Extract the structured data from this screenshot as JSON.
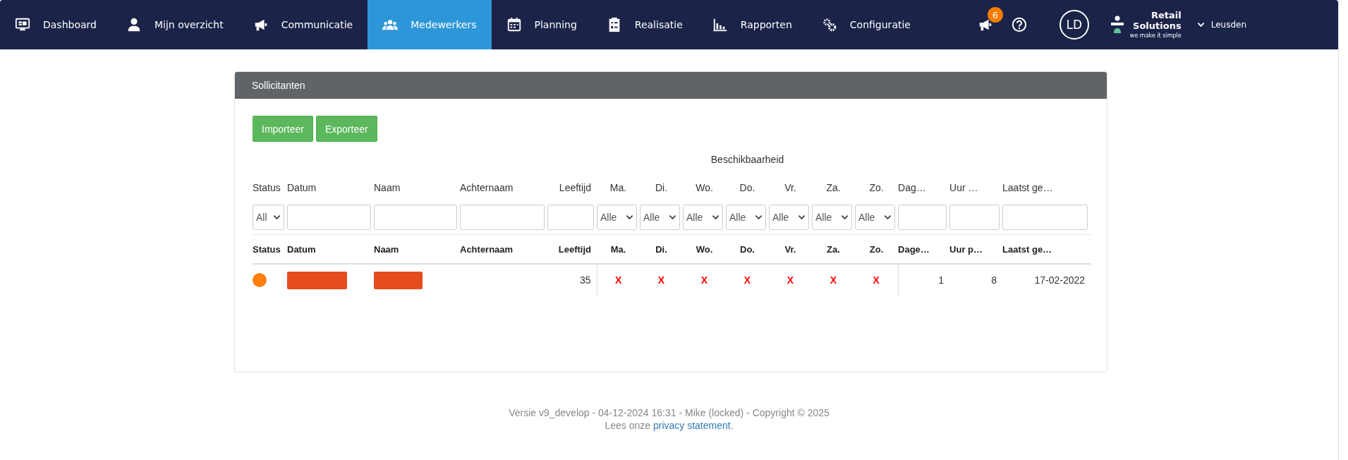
{
  "nav": {
    "items": [
      {
        "label": "Dashboard",
        "selected": false
      },
      {
        "label": "Mijn overzicht",
        "selected": false
      },
      {
        "label": "Communicatie",
        "selected": false
      },
      {
        "label": "Medewerkers",
        "selected": true
      },
      {
        "label": "Planning",
        "selected": false
      },
      {
        "label": "Realisatie",
        "selected": false
      },
      {
        "label": "Rapporten",
        "selected": false
      },
      {
        "label": "Configuratie",
        "selected": false
      }
    ],
    "notifications": {
      "count": "6"
    },
    "avatar": "LD",
    "logo": {
      "line_1": "Retail",
      "line_2": "Solutions",
      "tagline": "we make it simple"
    },
    "location": "Leusden"
  },
  "panel": {
    "title": "Sollicitanten",
    "buttons": [
      "Importeer",
      "Exporteer"
    ],
    "table": {
      "group_header": "Beschikbaarheid",
      "filter_labels": [
        "Status",
        "Datum",
        "Naam",
        "Achternaam",
        "Leeftijd",
        "Ma.",
        "Di.",
        "Wo.",
        "Do.",
        "Vr.",
        "Za.",
        "Zo.",
        "Dag…",
        "Uur …",
        "Laatst ge…"
      ],
      "filters": [
        {
          "kind": "select",
          "value": "All"
        },
        {
          "kind": "text"
        },
        {
          "kind": "text"
        },
        {
          "kind": "text"
        },
        {
          "kind": "text"
        },
        {
          "kind": "select",
          "value": "Alle"
        },
        {
          "kind": "select",
          "value": "Alle"
        },
        {
          "kind": "select",
          "value": "Alle"
        },
        {
          "kind": "select",
          "value": "Alle"
        },
        {
          "kind": "select",
          "value": "Alle"
        },
        {
          "kind": "select",
          "value": "Alle"
        },
        {
          "kind": "select",
          "value": "Alle"
        },
        {
          "kind": "text"
        },
        {
          "kind": "text"
        },
        {
          "kind": "text"
        }
      ],
      "columns": [
        "Status",
        "Datum",
        "Naam",
        "Achternaam",
        "Leeftijd",
        "Ma.",
        "Di.",
        "Wo.",
        "Do.",
        "Vr.",
        "Za.",
        "Zo.",
        "Dage…",
        "Uur p…",
        "Laatst ge…"
      ],
      "rows": [
        {
          "cells": [
            {
              "kind": "dot",
              "color": "#ff7f0e"
            },
            {
              "kind": "redacted"
            },
            {
              "kind": "redacted"
            },
            {
              "kind": "empty"
            },
            {
              "kind": "number",
              "text": "35"
            },
            {
              "kind": "mark",
              "text": "X"
            },
            {
              "kind": "mark",
              "text": "X"
            },
            {
              "kind": "mark",
              "text": "X"
            },
            {
              "kind": "mark",
              "text": "X"
            },
            {
              "kind": "mark",
              "text": "X"
            },
            {
              "kind": "mark",
              "text": "X"
            },
            {
              "kind": "mark",
              "text": "X"
            },
            {
              "kind": "number",
              "text": "1"
            },
            {
              "kind": "number",
              "text": "8"
            },
            {
              "kind": "number",
              "text": "17-02-2022"
            }
          ]
        }
      ]
    }
  },
  "footer": {
    "version": "Versie v9_develop - 04-12-2024 16:31 - Mike (locked) - Copyright © 2025",
    "privacy_prefix": "Lees onze",
    "privacy_link": "privacy statement",
    "privacy_suffix": "."
  }
}
